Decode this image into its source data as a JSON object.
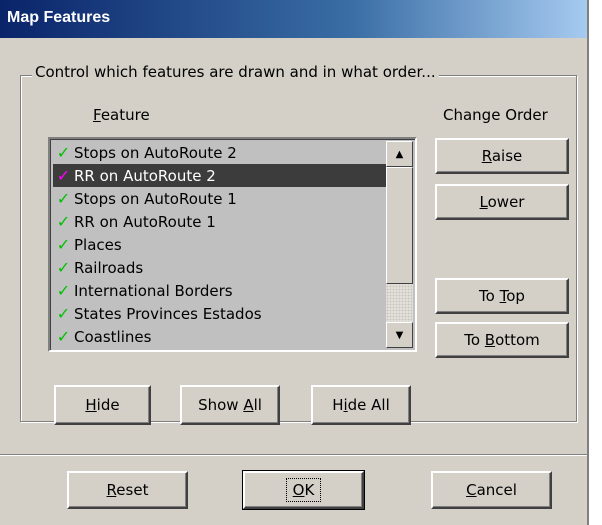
{
  "window": {
    "title": "Map Features"
  },
  "group": {
    "caption": "Control which features are drawn and in what order..."
  },
  "headers": {
    "feature": {
      "pre": "",
      "ul": "F",
      "post": "eature"
    },
    "change_order": "Change Order"
  },
  "list": {
    "items": [
      {
        "label": "Stops on AutoRoute 2",
        "check_color": "#00c000",
        "selected": false
      },
      {
        "label": "RR on AutoRoute 2",
        "check_color": "#ff00ff",
        "selected": true
      },
      {
        "label": "Stops on AutoRoute 1",
        "check_color": "#00c000",
        "selected": false
      },
      {
        "label": "RR on AutoRoute 1",
        "check_color": "#00c000",
        "selected": false
      },
      {
        "label": "Places",
        "check_color": "#00c000",
        "selected": false
      },
      {
        "label": "Railroads",
        "check_color": "#00c000",
        "selected": false
      },
      {
        "label": "International Borders",
        "check_color": "#00c000",
        "selected": false
      },
      {
        "label": "States Provinces Estados",
        "check_color": "#00c000",
        "selected": false
      },
      {
        "label": "Coastlines",
        "check_color": "#00c000",
        "selected": false
      }
    ],
    "check_glyph": "✓",
    "scroll_up_icon": "▲",
    "scroll_down_icon": "▼"
  },
  "order_buttons": {
    "raise": {
      "pre": "",
      "ul": "R",
      "post": "aise"
    },
    "lower": {
      "pre": "",
      "ul": "L",
      "post": "ower"
    },
    "to_top": {
      "pre": "To ",
      "ul": "T",
      "post": "op"
    },
    "to_bottom": {
      "pre": "To ",
      "ul": "B",
      "post": "ottom"
    }
  },
  "action_buttons": {
    "hide": {
      "pre": "",
      "ul": "H",
      "post": "ide"
    },
    "show_all": {
      "pre": "Show ",
      "ul": "A",
      "post": "ll"
    },
    "hide_all": {
      "pre": "H",
      "ul": "i",
      "post": "de All"
    }
  },
  "footer_buttons": {
    "reset": {
      "pre": "",
      "ul": "R",
      "post": "eset"
    },
    "ok": {
      "pre": "",
      "ul": "O",
      "post": "K"
    },
    "cancel": {
      "pre": "",
      "ul": "C",
      "post": "ancel"
    }
  },
  "colors": {
    "face": "#d4d0c8",
    "title_start": "#0a246a",
    "selection": "#3c3c3c",
    "check_on": "#00c000",
    "check_selected": "#ff00ff"
  }
}
